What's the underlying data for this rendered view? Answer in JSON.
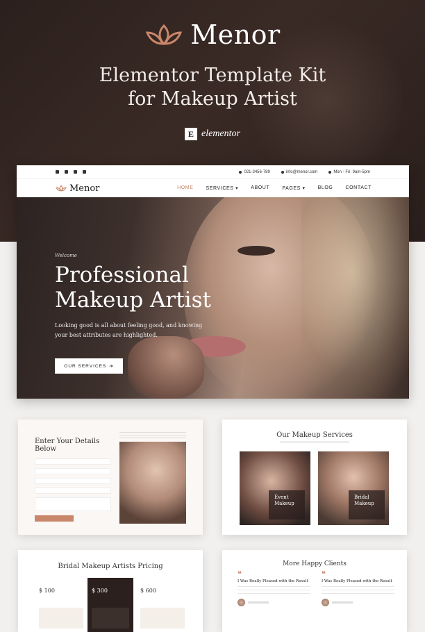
{
  "colors": {
    "accent": "#c8866a",
    "dark": "#2b201d"
  },
  "brand": {
    "name": "Menor",
    "logo_icon": "lotus-icon"
  },
  "kit_title_line1": "Elementor Template Kit",
  "kit_title_line2": "for Makeup Artist",
  "elementor": {
    "mark": "E",
    "word": "elementor"
  },
  "topbar": {
    "phone": "021-3456-789",
    "email": "info@menor.com",
    "hours": "Mon - Fri: 9am-5pm",
    "social_icons": [
      "facebook-icon",
      "twitter-icon",
      "instagram-icon",
      "youtube-icon"
    ]
  },
  "nav": {
    "logo": "Menor",
    "items": [
      "HOME",
      "SERVICES",
      "ABOUT",
      "PAGES",
      "BLOG",
      "CONTACT"
    ]
  },
  "hero": {
    "welcome": "Welcome",
    "headline_line1": "Professional",
    "headline_line2": "Makeup Artist",
    "lead": "Looking good is all about feeling good, and knowing your best attributes are highlighted.",
    "cta": "OUR SERVICES"
  },
  "contact_card": {
    "heading": "Enter Your Details Below"
  },
  "services_card": {
    "heading": "Our Makeup Services",
    "items": [
      {
        "label_line1": "Event",
        "label_line2": "Makeup"
      },
      {
        "label_line1": "Bridal",
        "label_line2": "Makeup"
      }
    ]
  },
  "pricing_card": {
    "heading": "Bridal Makeup Artists Pricing",
    "plans": [
      {
        "price": "$ 100"
      },
      {
        "price": "$ 300"
      },
      {
        "price": "$ 600"
      }
    ]
  },
  "testimonials_card": {
    "heading": "More Happy Clients",
    "items": [
      {
        "title": "I Was Really Pleased with the Result"
      },
      {
        "title": "I Was Really Pleased with the Result"
      }
    ]
  }
}
